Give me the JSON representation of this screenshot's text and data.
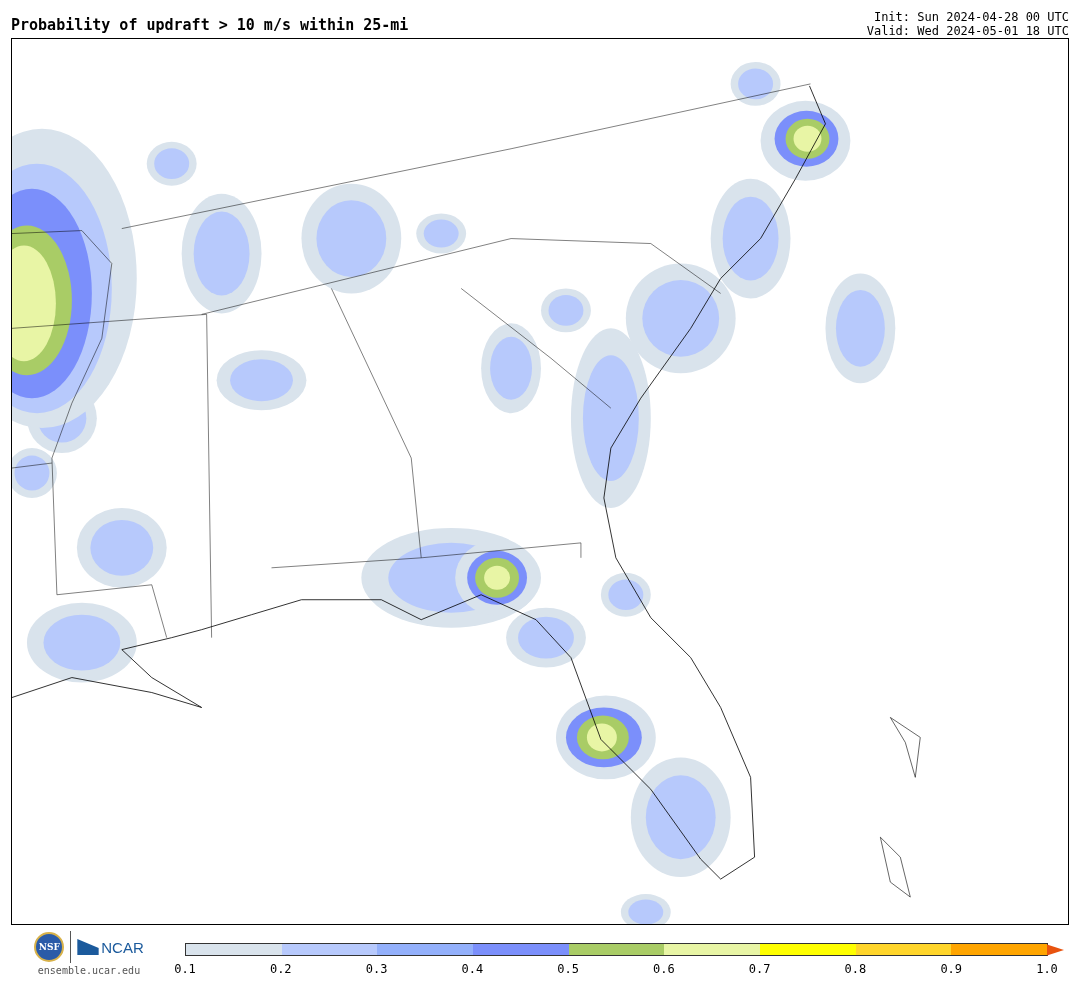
{
  "title": "Probability of updraft > 10 m/s within 25-mi",
  "init": "Init: Sun 2024-04-28 00 UTC",
  "valid": "Valid: Wed 2024-05-01 18 UTC",
  "logos": {
    "nsf": "NSF",
    "ncar": "NCAR",
    "site": "ensemble.ucar.edu"
  },
  "colorbar": {
    "segments": [
      {
        "color": "#d9e3ec"
      },
      {
        "color": "#b7c9fc"
      },
      {
        "color": "#93b0fb"
      },
      {
        "color": "#7b8ffb"
      },
      {
        "color": "#a9cc66"
      },
      {
        "color": "#e8f5a5"
      },
      {
        "color": "#ffff00"
      },
      {
        "color": "#ffd52b"
      },
      {
        "color": "#ffa500"
      }
    ],
    "extensions": [
      {
        "kind": "arrow",
        "color": "#e8530f"
      }
    ],
    "ticks": [
      "0.1",
      "0.2",
      "0.3",
      "0.4",
      "0.5",
      "0.6",
      "0.7",
      "0.8",
      "0.9",
      "1.0"
    ]
  }
}
